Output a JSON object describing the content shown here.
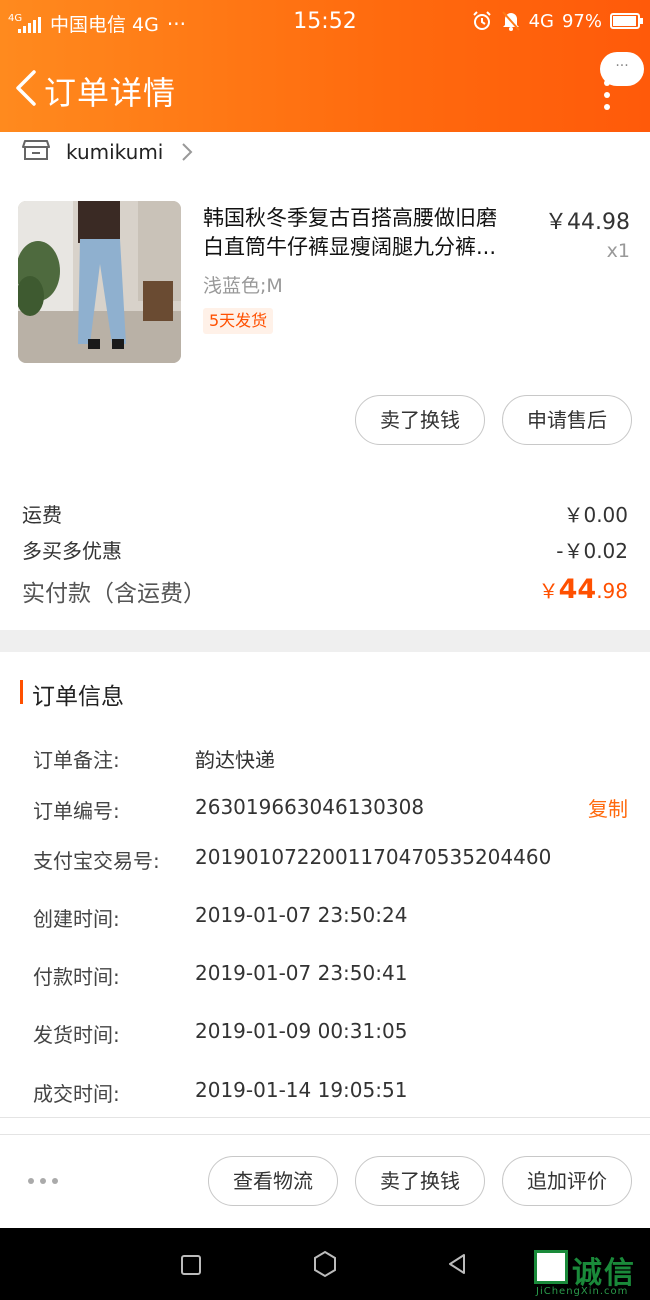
{
  "status_bar": {
    "network_badge": "4G",
    "carrier": "中国电信 4G",
    "more": "···",
    "time": "15:52",
    "network": "4G",
    "battery": "97%"
  },
  "header": {
    "title": "订单详情",
    "menu_bubble": "···"
  },
  "shop": {
    "name": "kumikumi"
  },
  "product": {
    "title_line1": "韩国秋冬季复古百搭高腰做旧磨",
    "title_line2": "白直筒牛仔裤显瘦阔腿九分裤...",
    "price": "￥44.98",
    "qty": "x1",
    "sku": "浅蓝色;M",
    "ship_tag": "5天发货"
  },
  "item_actions": {
    "sell": "卖了换钱",
    "after_sale": "申请售后"
  },
  "fees": {
    "shipping_label": "运费",
    "shipping_value": "￥0.00",
    "discount_label": "多买多优惠",
    "discount_value": "-￥0.02",
    "paid_label": "实付款（含运费）",
    "paid_symbol": "￥",
    "paid_int": "44",
    "paid_dec": ".98"
  },
  "order_info": {
    "title": "订单信息",
    "remark_label": "订单备注:",
    "remark_value": "韵达快递",
    "order_no_label": "订单编号:",
    "order_no_value": "263019663046130308",
    "copy": "复制",
    "alipay_label": "支付宝交易号:",
    "alipay_value": "2019010722001170470535204460",
    "created_label": "创建时间:",
    "created_value": "2019-01-07 23:50:24",
    "paid_time_label": "付款时间:",
    "paid_time_value": "2019-01-07 23:50:41",
    "shipped_label": "发货时间:",
    "shipped_value": "2019-01-09 00:31:05",
    "closed_label": "成交时间:",
    "closed_value": "2019-01-14 19:05:51"
  },
  "bottom_actions": {
    "logistics": "查看物流",
    "sell": "卖了换钱",
    "review": "追加评价"
  },
  "watermark": {
    "text": "诚信",
    "sub": "JiChengXin.com"
  },
  "colors": {
    "accent": "#ff5000",
    "header_start": "#ff8a1e",
    "header_end": "#ff5a0a"
  }
}
